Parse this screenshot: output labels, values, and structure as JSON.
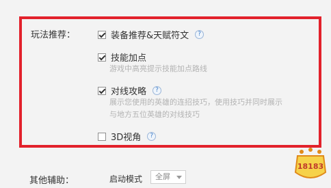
{
  "gameplay": {
    "label": "玩法推荐：",
    "options": [
      {
        "label": "装备推荐&天赋符文",
        "checked": true,
        "has_help": true
      },
      {
        "label": "技能加点",
        "checked": true,
        "has_help": false,
        "description": "游戏中高亮提示技能加点路线"
      },
      {
        "label": "对线攻略",
        "checked": true,
        "has_help": true,
        "description_line1": "展示您使用的英雄的连招技巧，使用技巧并同时展示",
        "description_line2": "与地方五位英雄的对线技巧"
      },
      {
        "label": "3D视角",
        "checked": false,
        "has_help": true
      }
    ],
    "help_glyph": "?"
  },
  "other": {
    "label": "其他辅助：",
    "launch_mode_label": "启动模式",
    "launch_mode_value": "全屏"
  },
  "watermark": {
    "text": "18183"
  },
  "colors": {
    "highlight_border": "#e2212b",
    "help_icon": "#3c7cc8"
  }
}
